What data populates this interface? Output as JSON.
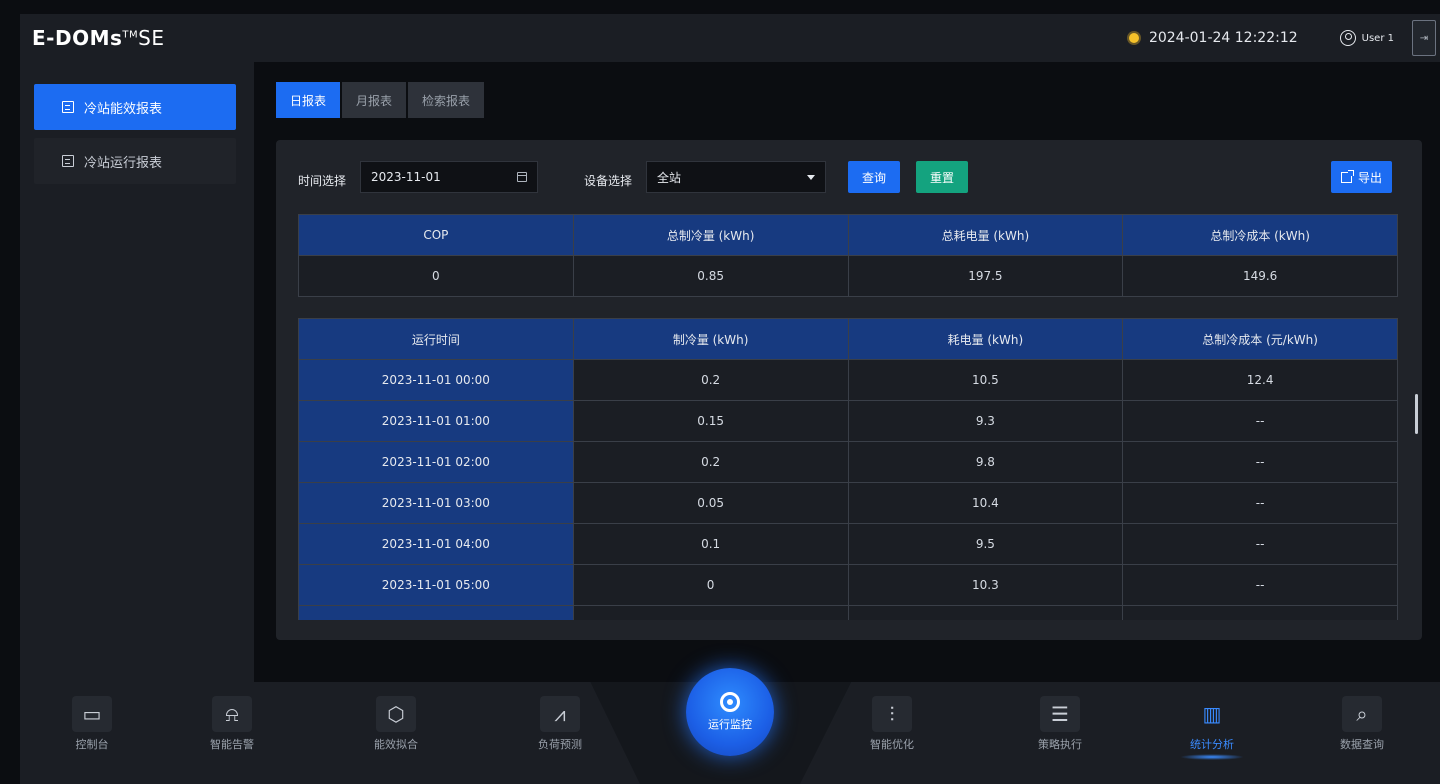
{
  "header": {
    "logo_main": "E-DOMs",
    "logo_tm": "TM",
    "logo_suffix": "SE",
    "datetime": "2024-01-24  12:22:12",
    "user": "User 1"
  },
  "sidebar": {
    "items": [
      {
        "label": "冷站能效报表",
        "active": true
      },
      {
        "label": "冷站运行报表",
        "active": false
      }
    ]
  },
  "tabs": [
    {
      "label": "日报表",
      "active": true
    },
    {
      "label": "月报表",
      "active": false
    },
    {
      "label": "检索报表",
      "active": false
    }
  ],
  "filters": {
    "time_label": "时间选择",
    "date_value": "2023-11-01",
    "device_label": "设备选择",
    "device_value": "全站",
    "query_label": "查询",
    "reset_label": "重置",
    "export_label": "导出"
  },
  "summary_table": {
    "headers": [
      "COP",
      "总制冷量 (kWh)",
      "总耗电量 (kWh)",
      "总制冷成本 (kWh)"
    ],
    "row": [
      "0",
      "0.85",
      "197.5",
      "149.6"
    ]
  },
  "detail_table": {
    "headers": [
      "运行时间",
      "制冷量 (kWh)",
      "耗电量 (kWh)",
      "总制冷成本 (元/kWh)"
    ],
    "rows": [
      [
        "2023-11-01 00:00",
        "0.2",
        "10.5",
        "12.4"
      ],
      [
        "2023-11-01 01:00",
        "0.15",
        "9.3",
        "--"
      ],
      [
        "2023-11-01 02:00",
        "0.2",
        "9.8",
        "--"
      ],
      [
        "2023-11-01 03:00",
        "0.05",
        "10.4",
        "--"
      ],
      [
        "2023-11-01 04:00",
        "0.1",
        "9.5",
        "--"
      ],
      [
        "2023-11-01 05:00",
        "0",
        "10.3",
        "--"
      ]
    ]
  },
  "bottom_nav": {
    "left": [
      {
        "label": "控制台",
        "icon": "monitor-icon"
      },
      {
        "label": "智能告警",
        "icon": "alarm-icon"
      },
      {
        "label": "能效拟合",
        "icon": "hexagon-check-icon"
      },
      {
        "label": "负荷预测",
        "icon": "trend-chart-icon"
      }
    ],
    "center": {
      "label": "运行监控",
      "icon": "monitor-eye-icon"
    },
    "right": [
      {
        "label": "智能优化",
        "icon": "sliders-icon",
        "active": false
      },
      {
        "label": "策略执行",
        "icon": "list-icon",
        "active": false
      },
      {
        "label": "统计分析",
        "icon": "bar-chart-icon",
        "active": true
      },
      {
        "label": "数据查询",
        "icon": "search-list-icon",
        "active": false
      }
    ]
  },
  "colors": {
    "accent": "#1c6cf2",
    "reset": "#14a37f",
    "table_header": "#173a80"
  }
}
